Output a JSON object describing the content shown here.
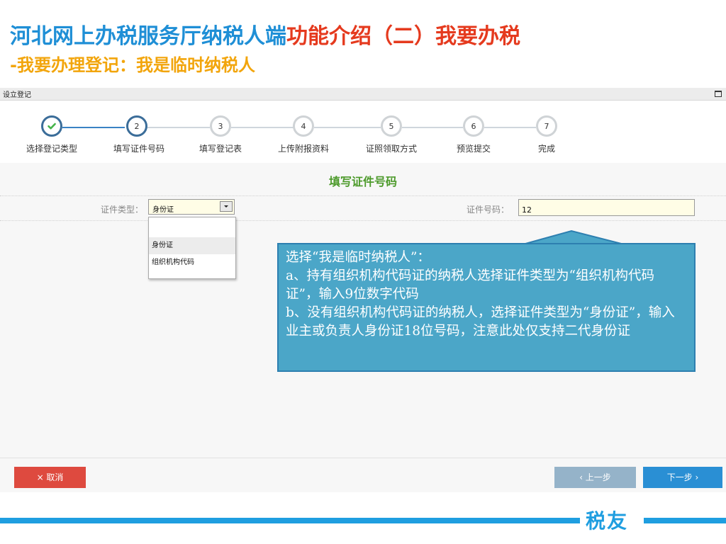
{
  "slide": {
    "title_part1": "河北网上办税服务厅纳税人端",
    "title_part2": "功能介绍（二）我要办税",
    "subtitle": "-我要办理登记：我是临时纳税人"
  },
  "window": {
    "title": "设立登记"
  },
  "steps": [
    {
      "number": "",
      "label": "选择登记类型",
      "state": "done"
    },
    {
      "number": "2",
      "label": "填写证件号码",
      "state": "active"
    },
    {
      "number": "3",
      "label": "填写登记表",
      "state": "pending"
    },
    {
      "number": "4",
      "label": "上传附报资料",
      "state": "pending"
    },
    {
      "number": "5",
      "label": "证照领取方式",
      "state": "pending"
    },
    {
      "number": "6",
      "label": "预览提交",
      "state": "pending"
    },
    {
      "number": "7",
      "label": "完成",
      "state": "pending"
    }
  ],
  "form": {
    "section_title": "填写证件号码",
    "cert_type_label": "证件类型：",
    "cert_type_value": "身份证",
    "cert_type_options": [
      "",
      "身份证",
      "组织机构代码"
    ],
    "cert_no_label": "证件号码：",
    "cert_no_value": "12"
  },
  "callout": {
    "line1": "选择“我是临时纳税人”：",
    "line2": "a、持有组织机构代码证的纳税人选择证件类型为“组织机构代码证”，输入9位数字代码",
    "line3": "b、没有组织机构代码证的纳税人，选择证件类型为“身份证”，输入业主或负责人身份证18位号码，注意此处仅支持二代身份证"
  },
  "buttons": {
    "cancel": "× 取消",
    "prev": "‹ 上一步",
    "next": "下一步 ›"
  },
  "brand": "税友",
  "colors": {
    "accent_blue": "#1f8fd6",
    "accent_red": "#e53a1e",
    "subtitle_orange": "#f2a50c",
    "section_green": "#4c9a2a",
    "callout_bg": "#4ba6c8",
    "cancel_red": "#de4a3f",
    "next_blue": "#2a8fd4"
  }
}
